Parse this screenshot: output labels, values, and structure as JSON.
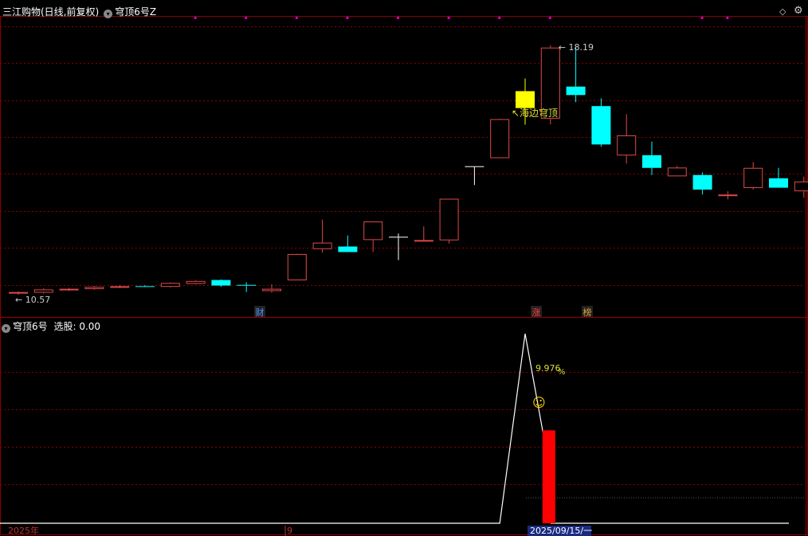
{
  "main_title": "三江购物(日线,前复权)",
  "main_indicator": "穹顶6号Z",
  "sub_title": "穹顶6号",
  "sub_value": "选股: 0.00",
  "labels": {
    "high_price": "18.19",
    "low_price": "10.57",
    "annotation": "海边穹顶",
    "pct": "9.976",
    "pct_unit": "%",
    "smiley": "☺"
  },
  "badges": [
    "财",
    "涨",
    "榜"
  ],
  "date_axis": {
    "year": "2025年",
    "month": "9",
    "cursor_date": "2025/09/15/一"
  },
  "colors": {
    "up": "#e04848",
    "down": "#00ffff",
    "yellow": "#ffff00",
    "white": "#ffffff",
    "grid": "#8b0000",
    "signal_bar": "#ff0000",
    "label_text": "#dddd33",
    "marker": "#cc00cc"
  },
  "chart_data": {
    "type": "candlestick",
    "ylim": [
      10.2,
      18.8
    ],
    "candles": [
      {
        "o": 10.6,
        "h": 10.62,
        "l": 10.52,
        "c": 10.57,
        "col": "up"
      },
      {
        "o": 10.58,
        "h": 10.72,
        "l": 10.56,
        "c": 10.68,
        "col": "up"
      },
      {
        "o": 10.66,
        "h": 10.73,
        "l": 10.63,
        "c": 10.7,
        "col": "up"
      },
      {
        "o": 10.69,
        "h": 10.79,
        "l": 10.67,
        "c": 10.76,
        "col": "up"
      },
      {
        "o": 10.74,
        "h": 10.82,
        "l": 10.72,
        "c": 10.78,
        "col": "up"
      },
      {
        "o": 10.77,
        "h": 10.81,
        "l": 10.75,
        "c": 10.78,
        "col": "down"
      },
      {
        "o": 10.76,
        "h": 10.9,
        "l": 10.74,
        "c": 10.88,
        "col": "up"
      },
      {
        "o": 10.85,
        "h": 10.96,
        "l": 10.84,
        "c": 10.94,
        "col": "up"
      },
      {
        "o": 10.97,
        "h": 10.99,
        "l": 10.76,
        "c": 10.8,
        "col": "down"
      },
      {
        "o": 10.8,
        "h": 10.9,
        "l": 10.6,
        "c": 10.82,
        "col": "down"
      },
      {
        "o": 10.63,
        "h": 10.84,
        "l": 10.58,
        "c": 10.7,
        "col": "up"
      },
      {
        "o": 10.96,
        "h": 11.78,
        "l": 10.96,
        "c": 11.77,
        "col": "up"
      },
      {
        "o": 11.92,
        "h": 12.83,
        "l": 11.81,
        "c": 12.12,
        "col": "up"
      },
      {
        "o": 12.0,
        "h": 12.34,
        "l": 11.87,
        "c": 11.83,
        "col": "down"
      },
      {
        "o": 12.2,
        "h": 12.52,
        "l": 11.83,
        "c": 12.77,
        "col": "up"
      },
      {
        "o": 12.3,
        "h": 12.4,
        "l": 11.58,
        "c": 12.3,
        "col": "white"
      },
      {
        "o": 12.2,
        "h": 12.62,
        "l": 12.2,
        "c": 12.19,
        "col": "up"
      },
      {
        "o": 12.19,
        "h": 13.46,
        "l": 12.09,
        "c": 13.47,
        "col": "up"
      },
      {
        "o": 14.47,
        "h": 14.47,
        "l": 13.89,
        "c": 14.47,
        "col": "white"
      },
      {
        "o": 14.72,
        "h": 15.93,
        "l": 14.72,
        "c": 15.92,
        "col": "up"
      },
      {
        "o": 16.78,
        "h": 17.17,
        "l": 15.75,
        "c": 16.26,
        "col": "yellow"
      },
      {
        "o": 15.93,
        "h": 18.19,
        "l": 15.76,
        "c": 18.12,
        "col": "up"
      },
      {
        "o": 16.92,
        "h": 18.13,
        "l": 16.44,
        "c": 16.66,
        "col": "down"
      },
      {
        "o": 16.32,
        "h": 16.56,
        "l": 15.07,
        "c": 15.14,
        "col": "down"
      },
      {
        "o": 14.8,
        "h": 16.07,
        "l": 14.55,
        "c": 15.42,
        "col": "up"
      },
      {
        "o": 14.81,
        "h": 15.23,
        "l": 14.2,
        "c": 14.42,
        "col": "down"
      },
      {
        "o": 14.16,
        "h": 14.48,
        "l": 14.18,
        "c": 14.43,
        "col": "up"
      },
      {
        "o": 14.2,
        "h": 14.28,
        "l": 13.6,
        "c": 13.75,
        "col": "down"
      },
      {
        "o": 13.6,
        "h": 13.7,
        "l": 13.45,
        "c": 13.6,
        "col": "up"
      },
      {
        "o": 13.8,
        "h": 14.6,
        "l": 13.75,
        "c": 14.42,
        "col": "up"
      },
      {
        "o": 14.1,
        "h": 14.42,
        "l": 13.81,
        "c": 13.81,
        "col": "down"
      },
      {
        "o": 13.7,
        "h": 14.15,
        "l": 13.5,
        "c": 14.0,
        "col": "up"
      }
    ],
    "signal_line": [
      {
        "i": 0,
        "v": 0
      },
      {
        "i": 19,
        "v": 0
      },
      {
        "i": 20,
        "v": 1
      },
      {
        "i": 21,
        "v": 0.26
      }
    ],
    "signal_bar": {
      "i": 21,
      "v": 0.49
    }
  }
}
